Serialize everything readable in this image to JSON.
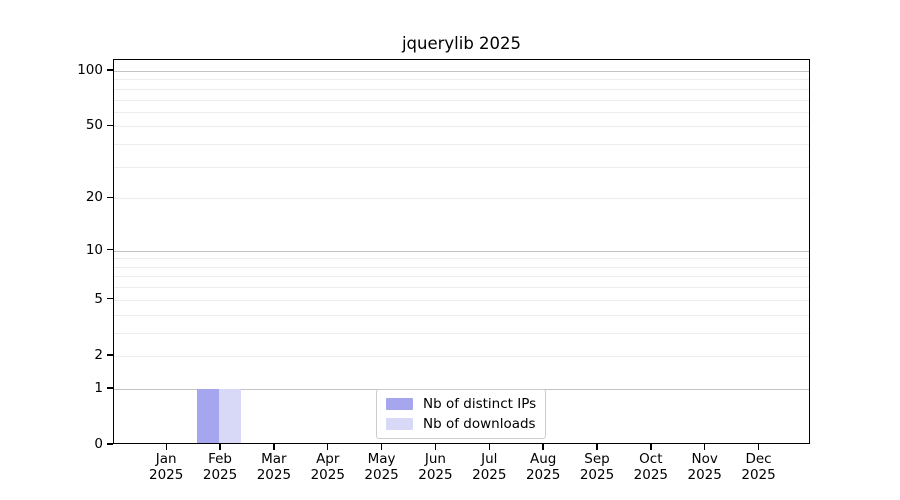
{
  "chart_data": {
    "type": "bar",
    "title": "jquerylib 2025",
    "categories": [
      {
        "month": "Jan",
        "year": "2025"
      },
      {
        "month": "Feb",
        "year": "2025"
      },
      {
        "month": "Mar",
        "year": "2025"
      },
      {
        "month": "Apr",
        "year": "2025"
      },
      {
        "month": "May",
        "year": "2025"
      },
      {
        "month": "Jun",
        "year": "2025"
      },
      {
        "month": "Jul",
        "year": "2025"
      },
      {
        "month": "Aug",
        "year": "2025"
      },
      {
        "month": "Sep",
        "year": "2025"
      },
      {
        "month": "Oct",
        "year": "2025"
      },
      {
        "month": "Nov",
        "year": "2025"
      },
      {
        "month": "Dec",
        "year": "2025"
      }
    ],
    "series": [
      {
        "name": "Nb of distinct IPs",
        "color": "#a6a6ef",
        "values": [
          0,
          1,
          0,
          0,
          0,
          0,
          0,
          0,
          0,
          0,
          0,
          0
        ]
      },
      {
        "name": "Nb of downloads",
        "color": "#d8d8f7",
        "values": [
          0,
          1,
          0,
          0,
          0,
          0,
          0,
          0,
          0,
          0,
          0,
          0
        ]
      }
    ],
    "xlabel": "",
    "ylabel": "",
    "y_scale": "log10(1+v)",
    "ylim": [
      0,
      114.6
    ],
    "y_ticks": [
      100,
      50,
      20,
      10,
      5,
      2,
      1,
      0
    ],
    "y_major_gridlines": [
      1,
      10,
      100
    ],
    "y_minor_gridlines": [
      2,
      3,
      4,
      5,
      6,
      7,
      8,
      9,
      20,
      30,
      40,
      50,
      60,
      70,
      80,
      90
    ],
    "grid": true,
    "legend_position": "lower center",
    "colors": {
      "major_grid": "#c3c3c3",
      "minor_grid": "#ececec",
      "spine": "#000000",
      "legend_border": "#cccccc",
      "background": "#ffffff",
      "text": "#000000"
    }
  }
}
